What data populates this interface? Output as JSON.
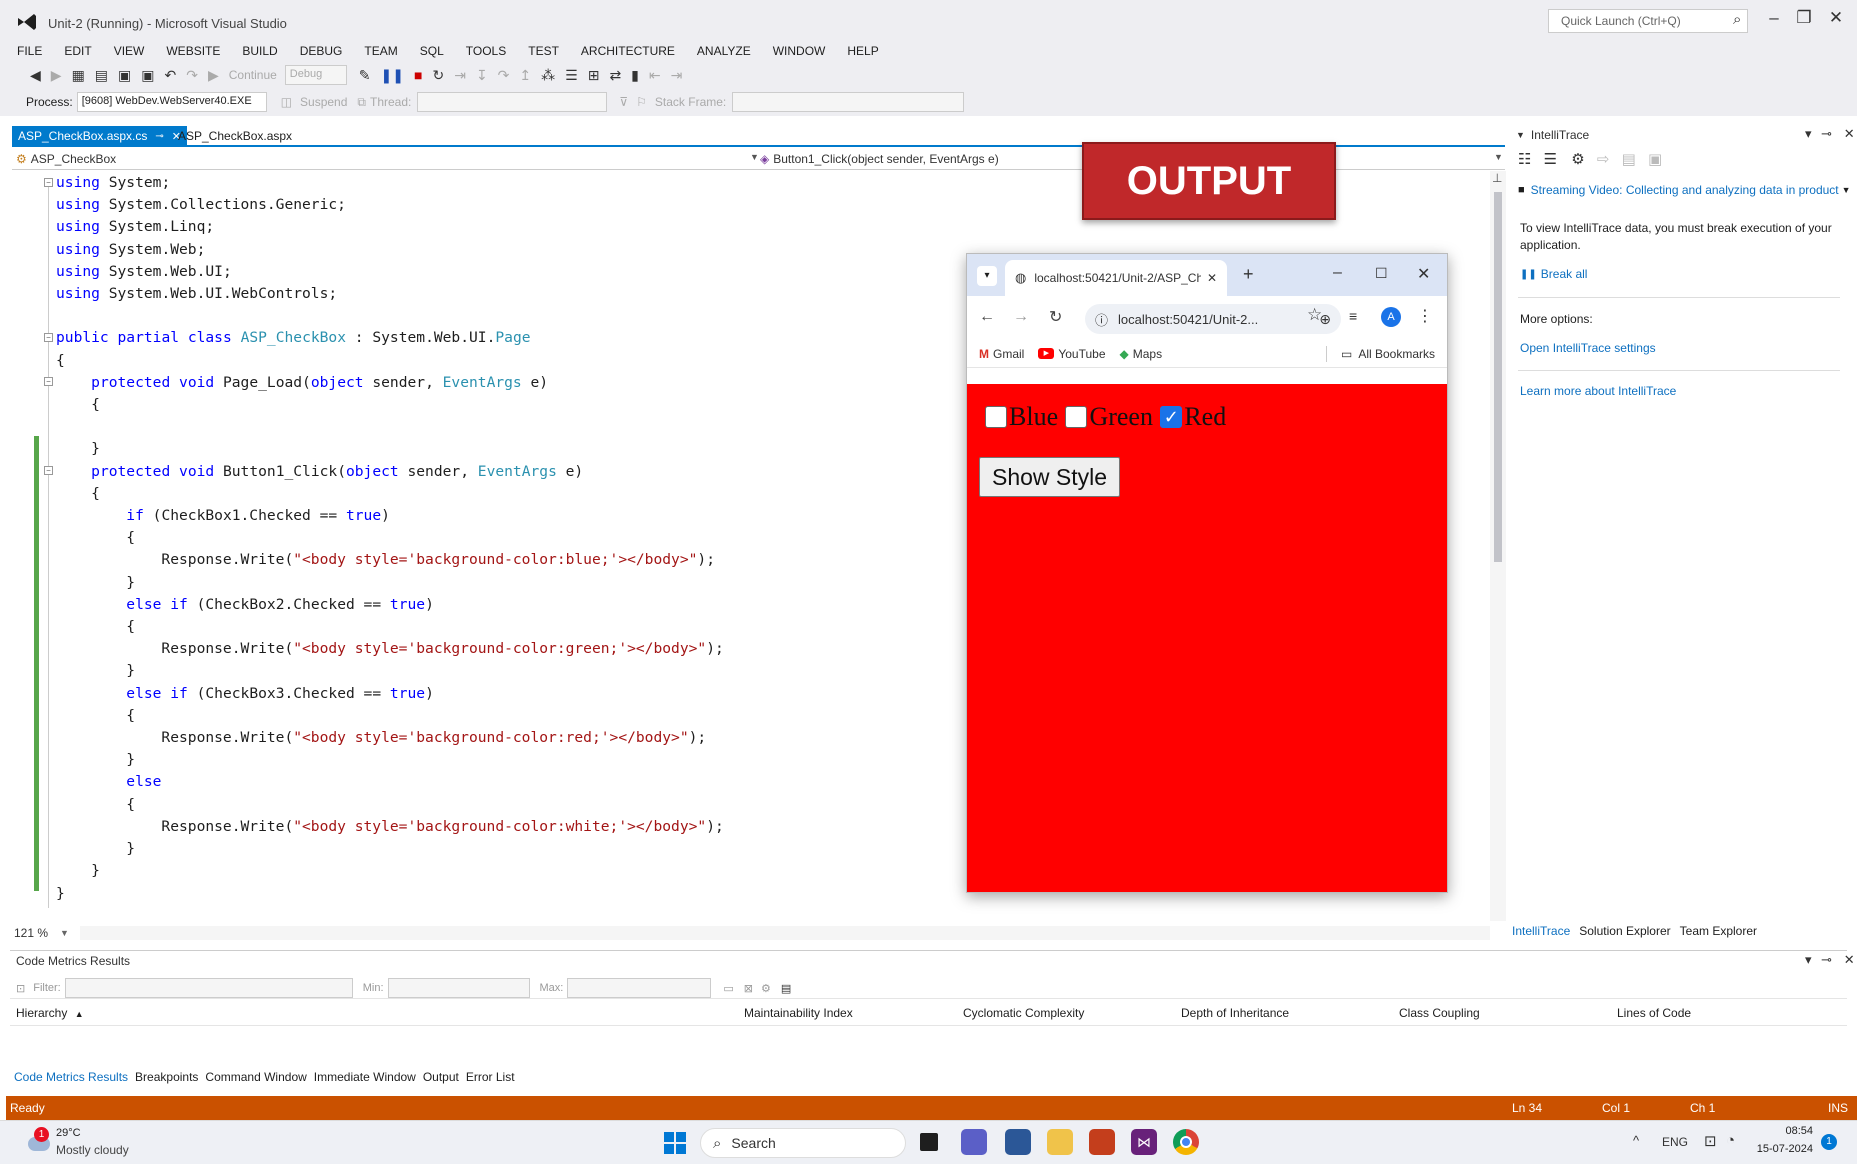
{
  "window": {
    "title": "Unit-2 (Running) - Microsoft Visual Studio",
    "quick_launch_placeholder": "Quick Launch (Ctrl+Q)"
  },
  "menu": [
    "FILE",
    "EDIT",
    "VIEW",
    "WEBSITE",
    "BUILD",
    "DEBUG",
    "TEAM",
    "SQL",
    "TOOLS",
    "TEST",
    "ARCHITECTURE",
    "ANALYZE",
    "WINDOW",
    "HELP"
  ],
  "toolbar": {
    "continue_label": "Continue",
    "config_value": "Debug",
    "process_label": "Process:",
    "process_value": "[9608] WebDev.WebServer40.EXE",
    "suspend_label": "Suspend",
    "thread_label": "Thread:",
    "stack_frame_label": "Stack Frame:"
  },
  "doc_tabs": {
    "active": "ASP_CheckBox.aspx.cs",
    "inactive": "ASP_CheckBox.aspx"
  },
  "nav": {
    "class_dropdown": "ASP_CheckBox",
    "member_dropdown": "Button1_Click(object sender, EventArgs e)"
  },
  "editor": {
    "zoom": "121 %"
  },
  "output_banner": "OUTPUT",
  "browser": {
    "tab_title": "localhost:50421/Unit-2/ASP_Ch",
    "url": "localhost:50421/Unit-2...",
    "bookmarks": [
      "Gmail",
      "YouTube",
      "Maps"
    ],
    "all_bookmarks": "All Bookmarks",
    "profile_initial": "A",
    "checkboxes": [
      {
        "label": "Blue",
        "checked": false
      },
      {
        "label": "Green",
        "checked": false
      },
      {
        "label": "Red",
        "checked": true
      }
    ],
    "button_label": "Show Style",
    "background_color": "#ff0000"
  },
  "intellitrace": {
    "title": "IntelliTrace",
    "streaming_link": "Streaming Video: Collecting and analyzing data in product",
    "message": "To view IntelliTrace data, you must break execution of your application.",
    "break_all": "Break all",
    "more_options": "More options:",
    "open_settings": "Open IntelliTrace settings",
    "learn_more": "Learn more about IntelliTrace",
    "bottom_tabs": [
      "IntelliTrace",
      "Solution Explorer",
      "Team Explorer"
    ]
  },
  "code_metrics": {
    "title": "Code Metrics Results",
    "filter_label": "Filter:",
    "min_label": "Min:",
    "max_label": "Max:",
    "columns": [
      "Hierarchy",
      "Maintainability Index",
      "Cyclomatic Complexity",
      "Depth of Inheritance",
      "Class Coupling",
      "Lines of Code"
    ],
    "bottom_tabs": [
      "Code Metrics Results",
      "Breakpoints",
      "Command Window",
      "Immediate Window",
      "Output",
      "Error List"
    ]
  },
  "status": {
    "left": "Ready",
    "ln": "Ln 34",
    "col": "Col 1",
    "ch": "Ch 1",
    "mode": "INS",
    "bar_color": "#ca5100"
  },
  "taskbar": {
    "weather_temp": "29°C",
    "weather_desc": "Mostly cloudy",
    "weather_badge": "1",
    "search_placeholder": "Search",
    "language": "ENG",
    "time": "08:54",
    "date": "15-07-2024",
    "notification_count": "1"
  },
  "code_lines": [
    "using System;",
    "using System.Collections.Generic;",
    "using System.Linq;",
    "using System.Web;",
    "using System.Web.UI;",
    "using System.Web.UI.WebControls;",
    "",
    "public partial class ASP_CheckBox : System.Web.UI.Page",
    "{",
    "    protected void Page_Load(object sender, EventArgs e)",
    "    {",
    "",
    "    }",
    "    protected void Button1_Click(object sender, EventArgs e)",
    "    {",
    "        if (CheckBox1.Checked == true)",
    "        {",
    "            Response.Write(\"<body style='background-color:blue;'></body>\");",
    "        }",
    "        else if (CheckBox2.Checked == true)",
    "        {",
    "            Response.Write(\"<body style='background-color:green;'></body>\");",
    "        }",
    "        else if (CheckBox3.Checked == true)",
    "        {",
    "            Response.Write(\"<body style='background-color:red;'></body>\");",
    "        }",
    "        else",
    "        {",
    "            Response.Write(\"<body style='background-color:white;'></body>\");",
    "        }",
    "    }",
    "}"
  ]
}
